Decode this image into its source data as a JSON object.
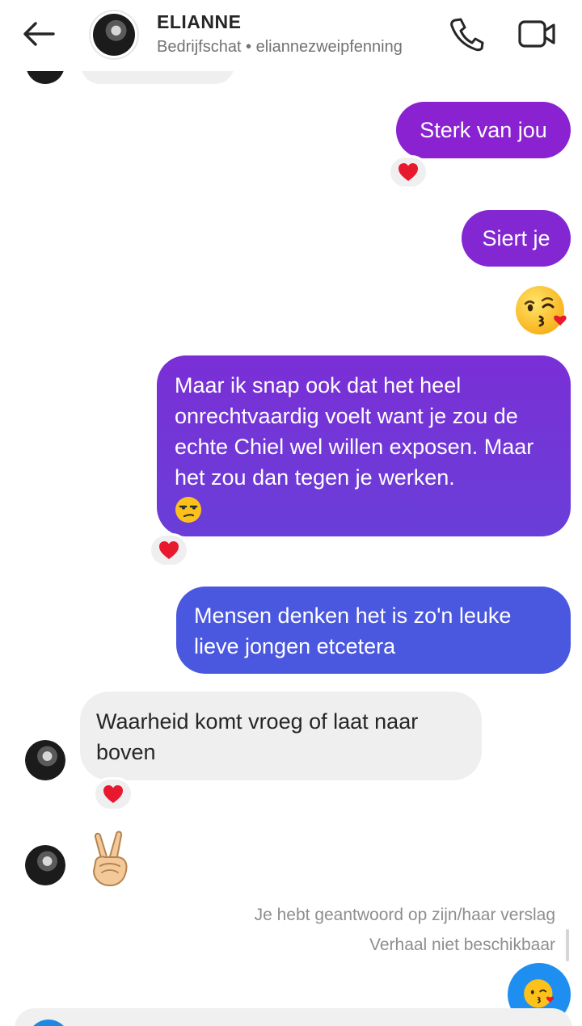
{
  "header": {
    "back_icon": "arrow-left-icon",
    "contact_name": "ELIANNE",
    "subtitle": "Bedrijfschat • eliannezweipfenning",
    "call_icon": "phone-icon",
    "video_icon": "video-camera-icon"
  },
  "messages": [
    {
      "from": "me",
      "text": "Sterk van jou",
      "reaction": "red-heart"
    },
    {
      "from": "me",
      "text": "Siert je"
    },
    {
      "from": "me",
      "emoji": "face-blowing-kiss"
    },
    {
      "from": "me",
      "text": "Maar ik snap ook dat het heel onrechtvaardig voelt want je zou de echte Chiel wel willen exposen. Maar het zou dan tegen je werken.",
      "trailing_emoji": "unamused-face",
      "reaction": "red-heart"
    },
    {
      "from": "me",
      "text": "Mensen denken  het is zo'n leuke lieve jongen etcetera"
    },
    {
      "from": "them",
      "text": "Waarheid komt vroeg of laat naar boven",
      "reaction": "red-heart"
    },
    {
      "from": "them",
      "emoji": "victory-hand"
    }
  ],
  "status": {
    "line1": "Je hebt geantwoord op zijn/haar verslag",
    "line2": "Verhaal niet beschikbaar"
  },
  "fab_icon": "face-blowing-kiss",
  "colors": {
    "bubble_purple": "#8a22d1",
    "bubble_violet": "#6a3ed8",
    "bubble_blue": "#4a57df",
    "bubble_gray": "#efefef",
    "accent_blue": "#1f8ef1"
  }
}
